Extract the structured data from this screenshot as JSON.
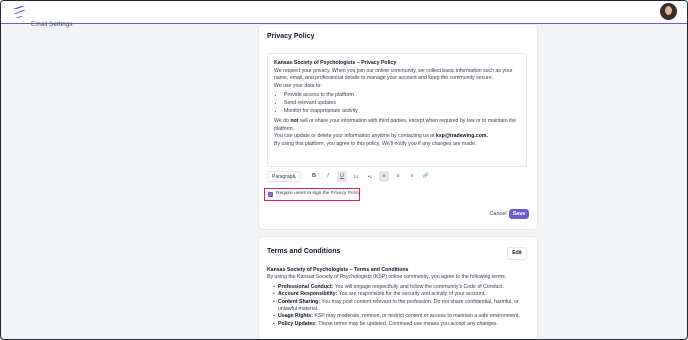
{
  "colors": {
    "accent": "#6d5bd0",
    "highlight": "#e11d6b"
  },
  "sidebar": {
    "email_settings": "Email Settings"
  },
  "privacy": {
    "title": "Privacy Policy",
    "heading": "Kansas Society of Psychologists – Privacy Policy",
    "intro": "We respect your privacy. When you join our online community, we collect basic information such as your name, email, and professional details to manage your account and keep the community secure.",
    "use_line": "We use your data to:",
    "uses": [
      "Provide access to the platform",
      "Send relevant updates",
      "Monitor for inappropriate activity"
    ],
    "share_pre": "We do ",
    "share_bold": "not",
    "share_post": " sell or share your information with third parties, except when required by law or to maintain the platform.",
    "contact_pre": "You can update or delete your information anytime by contacting us at ",
    "contact_email": "ksp@tradewing.com.",
    "agree": "By using this platform, you agree to this policy. We'll notify you if any changes are made.",
    "toolbar": {
      "paragraph": "Paragraph",
      "bold": "B",
      "italic": "I",
      "underline": "U",
      "ordered": "1≡",
      "bullet": "•≡",
      "align_left": "≡",
      "align_center": "≡",
      "align_right": "≡",
      "link": "🔗"
    },
    "checkbox_label": "Require users to sign the Privacy Policy",
    "cancel": "Cancel",
    "save": "Save"
  },
  "terms": {
    "title": "Terms and Conditions",
    "edit": "Edit",
    "heading": "Kansas Society of Psychologists – Terms and Conditions",
    "intro": "By using the Kansas Society of Psychologists (KSP) online community, you agree to the following terms:",
    "items": [
      {
        "label": "Professional Conduct:",
        "text": " You will engage respectfully and follow the community's Code of Conduct."
      },
      {
        "label": "Account Responsibility:",
        "text": " You are responsible for the security and activity of your account."
      },
      {
        "label": "Content Sharing:",
        "text": " You may post content relevant to the profession. Do not share confidential, harmful, or unlawful material."
      },
      {
        "label": "Usage Rights:",
        "text": " KSP may moderate, remove, or restrict content or access to maintain a safe environment."
      },
      {
        "label": "Policy Updates:",
        "text": " These terms may be updated. Continued use means you accept any changes."
      }
    ]
  }
}
